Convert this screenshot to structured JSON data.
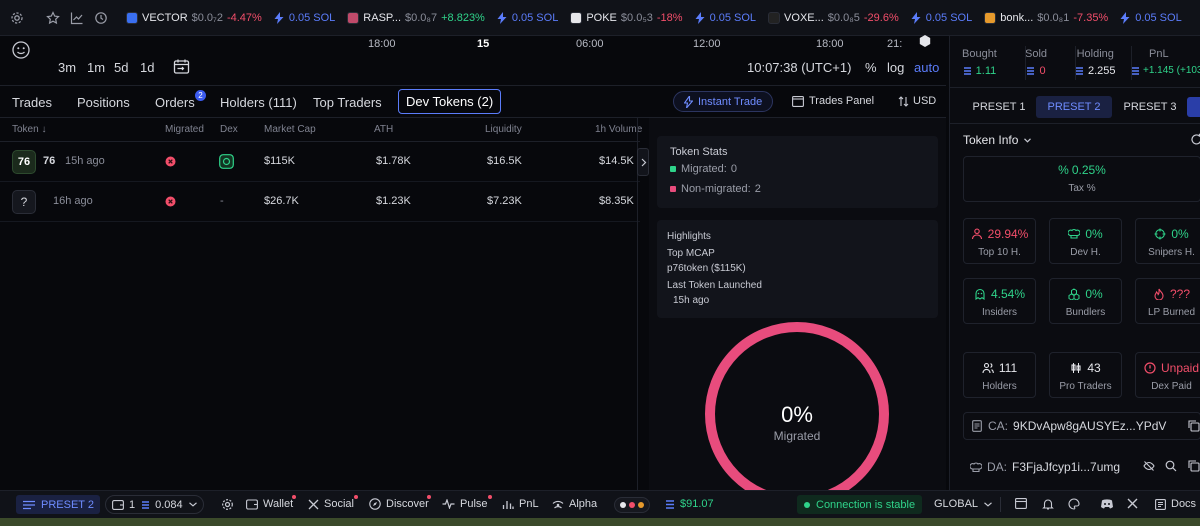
{
  "ticker": [
    {
      "symbol": "VECTOR",
      "price": "$0.0₇2",
      "change": "-4.47%",
      "dir": "down",
      "sol": "0.05 SOL",
      "color": "#3a6ff0"
    },
    {
      "symbol": "RASP...",
      "price": "$0.0₈7",
      "change": "+8.823%",
      "dir": "up",
      "sol": "0.05 SOL",
      "color": "#c04a6a"
    },
    {
      "symbol": "POKE",
      "price": "$0.0₅3",
      "change": "-18%",
      "dir": "down",
      "sol": "0.05 SOL",
      "color": "#e7e7ea"
    },
    {
      "symbol": "VOXE...",
      "price": "$0.0₈5",
      "change": "-29.6%",
      "dir": "down",
      "sol": "0.05 SOL",
      "color": "#222222"
    },
    {
      "symbol": "bonk...",
      "price": "$0.0₈1",
      "change": "-7.35%",
      "dir": "down",
      "sol": "0.05 SOL",
      "color": "#e79a2c"
    }
  ],
  "chart": {
    "timeframes": [
      "3m",
      "1m",
      "5d",
      "1d"
    ],
    "time_labels": [
      "18:00",
      "15",
      "06:00",
      "12:00",
      "18:00",
      "21:"
    ],
    "clock": "10:07:38 (UTC+1)",
    "pct": "%",
    "log": "log",
    "auto": "auto"
  },
  "tabs": {
    "trades": "Trades",
    "positions": "Positions",
    "orders": "Orders",
    "orders_badge": "2",
    "holders": "Holders (111)",
    "top_traders": "Top Traders",
    "dev_tokens": "Dev Tokens (2)",
    "instant_trade": "Instant Trade",
    "trades_panel": "Trades Panel",
    "currency": "USD"
  },
  "table": {
    "headers": {
      "token": "Token ↓",
      "migrated": "Migrated",
      "dex": "Dex",
      "mcap": "Market Cap",
      "ath": "ATH",
      "liquidity": "Liquidity",
      "vol": "1h Volume"
    },
    "rows": [
      {
        "logo": "76",
        "name": "76",
        "age": "15h ago",
        "dex": "",
        "mcap": "$115K",
        "ath": "$1.78K",
        "liquidity": "$16.5K",
        "vol": "$14.5K"
      },
      {
        "logo": "?",
        "name": "",
        "age": "16h ago",
        "dex": "-",
        "mcap": "$26.7K",
        "ath": "$1.23K",
        "liquidity": "$7.23K",
        "vol": "$8.35K"
      }
    ]
  },
  "token_stats": {
    "title": "Token Stats",
    "migrated_label": "Migrated:",
    "migrated_value": "0",
    "non_migrated_label": "Non-migrated:",
    "non_migrated_value": "2"
  },
  "highlights": {
    "title": "Highlights",
    "top_mcap_label": "Top MCAP",
    "top_mcap_value": "p76token ($115K)",
    "last_token_label": "Last Token Launched",
    "last_token_value": "15h ago"
  },
  "donut": {
    "value": "0%",
    "label": "Migrated",
    "migrated_fraction": 0,
    "color": "#e84c7d"
  },
  "sidebar": {
    "bought_label": "Bought",
    "bought_value": "1.11",
    "sold_label": "Sold",
    "sold_value": "0",
    "holding_label": "Holding",
    "holding_value": "2.255",
    "pnl_label": "PnL",
    "pnl_value": "+1.145 (+103",
    "presets": [
      "PRESET 1",
      "PRESET 2",
      "PRESET 3"
    ],
    "token_info": "Token Info",
    "tax_value": "0.25%",
    "tax_label": "Tax %",
    "grid": [
      {
        "value": "29.94%",
        "label": "Top 10 H.",
        "tone": "red",
        "icon": "user-star-icon"
      },
      {
        "value": "0%",
        "label": "Dev H.",
        "tone": "green",
        "icon": "chef-hat-icon"
      },
      {
        "value": "0%",
        "label": "Snipers H.",
        "tone": "green",
        "icon": "crosshair-icon"
      },
      {
        "value": "4.54%",
        "label": "Insiders",
        "tone": "green",
        "icon": "ghost-icon"
      },
      {
        "value": "0%",
        "label": "Bundlers",
        "tone": "green",
        "icon": "boxes-icon"
      },
      {
        "value": "???",
        "label": "LP Burned",
        "tone": "red",
        "icon": "flame-icon"
      },
      {
        "value": "111",
        "label": "Holders",
        "tone": "white",
        "icon": "users-icon"
      },
      {
        "value": "43",
        "label": "Pro Traders",
        "tone": "white",
        "icon": "candles-icon"
      },
      {
        "value": "Unpaid",
        "label": "Dex Paid",
        "tone": "red",
        "icon": "alert-circle-icon"
      }
    ],
    "ca_label": "CA:",
    "ca_value": "9KDvApw8gAUSYEz...YPdV",
    "da_label": "DA:",
    "da_value": "F3FjaJfcyp1i...7umg"
  },
  "bottom": {
    "preset": "PRESET 2",
    "wallets": "1",
    "balance": "0.084",
    "wallet": "Wallet",
    "social": "Social",
    "discover": "Discover",
    "pulse": "Pulse",
    "pnl": "PnL",
    "alpha": "Alpha",
    "sol_price": "$91.07",
    "connection": "Connection is stable",
    "region": "GLOBAL",
    "docs": "Docs"
  }
}
